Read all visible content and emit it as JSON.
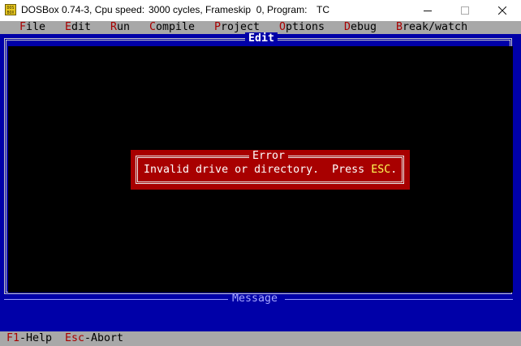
{
  "window": {
    "title_app": "DOSBox 0.74-3, Cpu speed:",
    "title_cycles": "3000 cycles, Frameskip  0, Program:",
    "title_program": "TC",
    "icon_text": "DOS BOX"
  },
  "menubar": {
    "items": [
      {
        "hotkey": "F",
        "rest": "ile"
      },
      {
        "hotkey": "E",
        "rest": "dit"
      },
      {
        "hotkey": "R",
        "rest": "un"
      },
      {
        "hotkey": "C",
        "rest": "ompile"
      },
      {
        "hotkey": "P",
        "rest": "roject"
      },
      {
        "hotkey": "O",
        "rest": "ptions"
      },
      {
        "hotkey": "D",
        "rest": "ebug"
      },
      {
        "hotkey": "B",
        "rest": "reak/watch"
      }
    ]
  },
  "edit_window": {
    "title": "Edit"
  },
  "error_dialog": {
    "title": "Error",
    "message": "Invalid drive or directory.  Press ",
    "key": "ESC",
    "suffix": "."
  },
  "message_window": {
    "title": "Message"
  },
  "statusbar": {
    "items": [
      {
        "hotkey": "F1",
        "rest": "-Help"
      },
      {
        "hotkey": "Esc",
        "rest": "-Abort"
      }
    ]
  },
  "colors": {
    "dos_blue": "#0000a8",
    "menu_gray": "#a8a8a8",
    "hotkey_red": "#a80000",
    "dialog_red": "#a80000",
    "highlight_yellow": "#ffff55"
  }
}
